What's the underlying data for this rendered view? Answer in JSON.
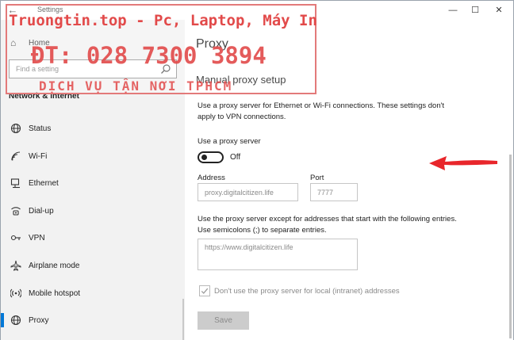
{
  "window": {
    "title": "Settings",
    "controls": {
      "minimize": "—",
      "maximize": "☐",
      "close": "✕"
    }
  },
  "sidebar": {
    "home_label": "Home",
    "search_placeholder": "Find a setting",
    "section_title": "Network & Internet",
    "items": [
      {
        "label": "Status",
        "icon": "globe-icon"
      },
      {
        "label": "Wi-Fi",
        "icon": "wifi-icon"
      },
      {
        "label": "Ethernet",
        "icon": "ethernet-icon"
      },
      {
        "label": "Dial-up",
        "icon": "dial-up-icon"
      },
      {
        "label": "VPN",
        "icon": "vpn-icon"
      },
      {
        "label": "Airplane mode",
        "icon": "airplane-icon"
      },
      {
        "label": "Mobile hotspot",
        "icon": "hotspot-icon"
      },
      {
        "label": "Proxy",
        "icon": "globe-icon",
        "active": true
      }
    ]
  },
  "main": {
    "page_title": "Proxy",
    "section_title": "Manual proxy setup",
    "description": "Use a proxy server for Ethernet or Wi-Fi connections. These settings don't apply to VPN connections.",
    "use_proxy_label": "Use a proxy server",
    "toggle_state": "Off",
    "toggle_on": false,
    "address_label": "Address",
    "address_value": "proxy.digitalcitizen.life",
    "port_label": "Port",
    "port_value": "7777",
    "exceptions_description": "Use the proxy server except for addresses that start with the following entries. Use semicolons (;) to separate entries.",
    "exceptions_value": "https://www.digitalcitizen.life",
    "bypass_local_label": "Don't use the proxy server for local (intranet) addresses",
    "bypass_local_checked": true,
    "save_label": "Save"
  },
  "watermark": {
    "line1": "Truongtin.top - Pc, Laptop, Máy In",
    "line2": "ĐT: 028 7300 3894",
    "line3": "DỊCH VỤ TẬN NƠI TPHCM"
  },
  "colors": {
    "accent": "#0078d7",
    "sidebar_bg": "#f2f2f2",
    "arrow": "#e8262b",
    "watermark": "#e24a4a"
  }
}
